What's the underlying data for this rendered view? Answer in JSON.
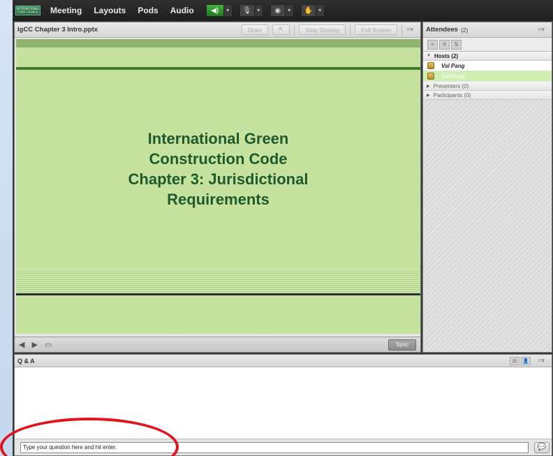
{
  "menubar": {
    "logo_text": "INTERNATIONAL CODE COUNCIL",
    "items": [
      "Meeting",
      "Layouts",
      "Pods",
      "Audio"
    ]
  },
  "share_pod": {
    "title": "IgCC Chapter 3 Intro.pptx",
    "buttons": {
      "draw": "Draw",
      "stop_sharing": "Stop Sharing",
      "full_screen": "Full Screen"
    },
    "slide_title_lines": [
      "International Green",
      "Construction Code",
      "Chapter 3: Jurisdictional",
      "Requirements"
    ],
    "sync_label": "Sync"
  },
  "attendees": {
    "title": "Attendees",
    "count": "(2)",
    "hosts": "Hosts (2)",
    "host_users": [
      "Val Pang",
      "Val Pang"
    ],
    "presenters": "Presenters (0)",
    "participants": "Participants (0)"
  },
  "qa": {
    "title": "Q & A",
    "input_value": "Type your question here and hit enter."
  },
  "colors": {
    "slide_bg": "#c5e29e",
    "slide_text": "#1f5a2c",
    "highlight_circle": "#e3131b"
  }
}
